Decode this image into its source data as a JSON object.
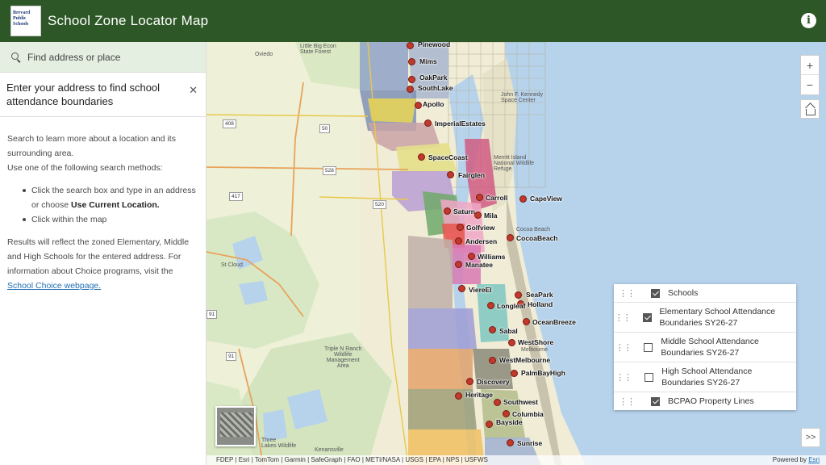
{
  "header": {
    "title": "School Zone Locator Map",
    "logo_text": [
      "Brevard",
      "Public",
      "Schools"
    ],
    "info_icon": "info-icon"
  },
  "search": {
    "placeholder": "Find address or place"
  },
  "panel": {
    "heading": "Enter your address to find school attendance boundaries",
    "intro": "Search to learn more about a location and its surrounding area.",
    "methods_intro": "Use one of the following search methods:",
    "method_1_prefix": "Click the search box and type in an address or choose ",
    "method_1_bold": "Use Current Location.",
    "method_2": "Click within the map",
    "results_text": "Results will reflect the zoned Elementary, Middle and High Schools for the entered address. For information about Choice programs, visit the",
    "link": "School Choice webpage."
  },
  "map": {
    "zoom_in": "+",
    "zoom_out": "−",
    "places": [
      {
        "name": "Little Big Econ State Forest",
        "lines": [
          "Little Big Econ",
          "State Forest"
        ]
      },
      {
        "name": "Oviedo"
      },
      {
        "name": "Kennedy Space Center",
        "lines": [
          "John F. Kennedy",
          "Space Center"
        ]
      },
      {
        "name": "Merritt Island National Wildlife Refuge",
        "lines": [
          "Merritt Island",
          "National Wildlife",
          "Refuge"
        ]
      },
      {
        "name": "Cocoa Beach"
      },
      {
        "name": "St Cloud"
      },
      {
        "name": "Triple N Ranch Wildlife Management Area",
        "lines": [
          "Triple N Ranch",
          "Wildlife",
          "Management",
          "Area"
        ]
      },
      {
        "name": "Three Lakes Wildlife",
        "lines": [
          "Three",
          "Lakes Wildlife"
        ]
      },
      {
        "name": "Kenansville"
      },
      {
        "name": "Melbourne"
      }
    ],
    "roads": [
      "408",
      "50",
      "528",
      "417",
      "520",
      "91",
      "91"
    ],
    "schools": [
      "Pinewood",
      "Mims",
      "OakPark",
      "SouthLake",
      "Apollo",
      "ImperialEstates",
      "SpaceCoast",
      "Fairglen",
      "Carroll",
      "CapeView",
      "Saturn",
      "Mila",
      "Golfview",
      "CocoaBeach",
      "Andersen",
      "Williams",
      "Manatee",
      "ViereEl",
      "SeaPark",
      "Holland",
      "Longleaf",
      "OceanBreeze",
      "Sabal",
      "WestShore",
      "WestMelbourne",
      "PalmBayHigh",
      "Discovery",
      "Heritage",
      "Southwest",
      "Columbia",
      "Bayside",
      "Sunrise"
    ]
  },
  "layers": [
    {
      "label": "Schools",
      "checked": true
    },
    {
      "label": "Elementary School Attendance Boundaries SY26-27",
      "checked": true
    },
    {
      "label": "Middle School Attendance Boundaries SY26-27",
      "checked": false
    },
    {
      "label": "High School Attendance Boundaries SY26-27",
      "checked": false
    },
    {
      "label": "BCPAO Property Lines",
      "checked": true
    }
  ],
  "attribution": "FDEP | Esri | TomTom | Garmin | SafeGraph | FAO | METI/NASA | USGS | EPA | NPS | USFWS",
  "powered_by": {
    "prefix": "Powered by ",
    "link": "Esri"
  },
  "colors": {
    "header": "#2e5727",
    "search_bg": "#e4efe2",
    "water": "#b7d3ec",
    "land": "#f0ecd6",
    "pin": "#c0392b"
  }
}
